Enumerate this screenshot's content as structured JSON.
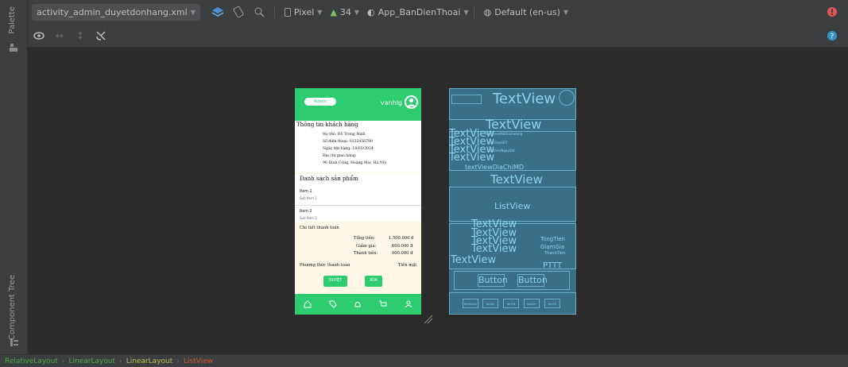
{
  "left_panel": {
    "palette_label": "Palette",
    "component_tree_label": "Component Tree"
  },
  "toolbar": {
    "file_name": "activity_admin_duyetdonhang.xml",
    "device": "Pixel",
    "api_level": "34",
    "theme": "App_BanDienThoai",
    "locale": "Default (en-us)",
    "error_color": "#e05555",
    "help_color": "#3592c4"
  },
  "breadcrumb": [
    "RelativeLayout",
    "LinearLayout",
    "LinearLayout",
    "ListView"
  ],
  "phone": {
    "admin_pill": "Admin",
    "username": "vanhlg",
    "customer_title": "Thông tin khách hàng",
    "customer_lines": [
      "Họ tên: Đỗ Trung Ninh",
      "Số điện thoại: 0123456789",
      "Ngày đặt hàng: 18/03/2024",
      "Địa chỉ giao hàng:",
      "96 Định Công, Hoàng Mai, Hà Nội"
    ],
    "list_title": "Danh sách sản phẩm",
    "items": [
      {
        "title": "Item 1",
        "sub": "Sub Item 1"
      },
      {
        "title": "Item 2",
        "sub": "Sub Item 2"
      }
    ],
    "payment_title": "Chi tiết thanh toán",
    "payment_rows": [
      {
        "label": "Tổng tiền:",
        "value": "1.500.000 đ"
      },
      {
        "label": "Giảm giá:",
        "value": "600.000 đ"
      },
      {
        "label": "Thành tiền:",
        "value": "900.000 đ"
      }
    ],
    "payment_method_label": "Phương thức thanh toán",
    "payment_method_value": "Tiền mặt",
    "approve_button": "DUYỆT",
    "delete_button": "XÓA",
    "accent_color": "#2dcc6f"
  },
  "blueprint": {
    "top_text": "TextView",
    "customer_text": "TextView",
    "rows_text": [
      "TextView",
      "TextView",
      "TextView",
      "TextView"
    ],
    "address_text": "textViewDiaChiMD",
    "list_title_text": "TextView",
    "listview_text": "ListView",
    "payment_texts": [
      "TextView",
      "TextView",
      "TextView",
      "TextView",
      "TextView"
    ],
    "tongtien": "TongTien",
    "giamgia": "GiamGia",
    "thanhtien": "ThanhTien",
    "pttt": "PTTT",
    "button1": "Button",
    "button2": "Button",
    "small_labels": [
      "textViewMaKhachHang",
      "textViewSDT",
      "textViewNgayDat"
    ],
    "nav_labels": [
      "btnHome",
      "btnSp",
      "btnTB",
      "btnGH",
      "btnTK"
    ]
  }
}
